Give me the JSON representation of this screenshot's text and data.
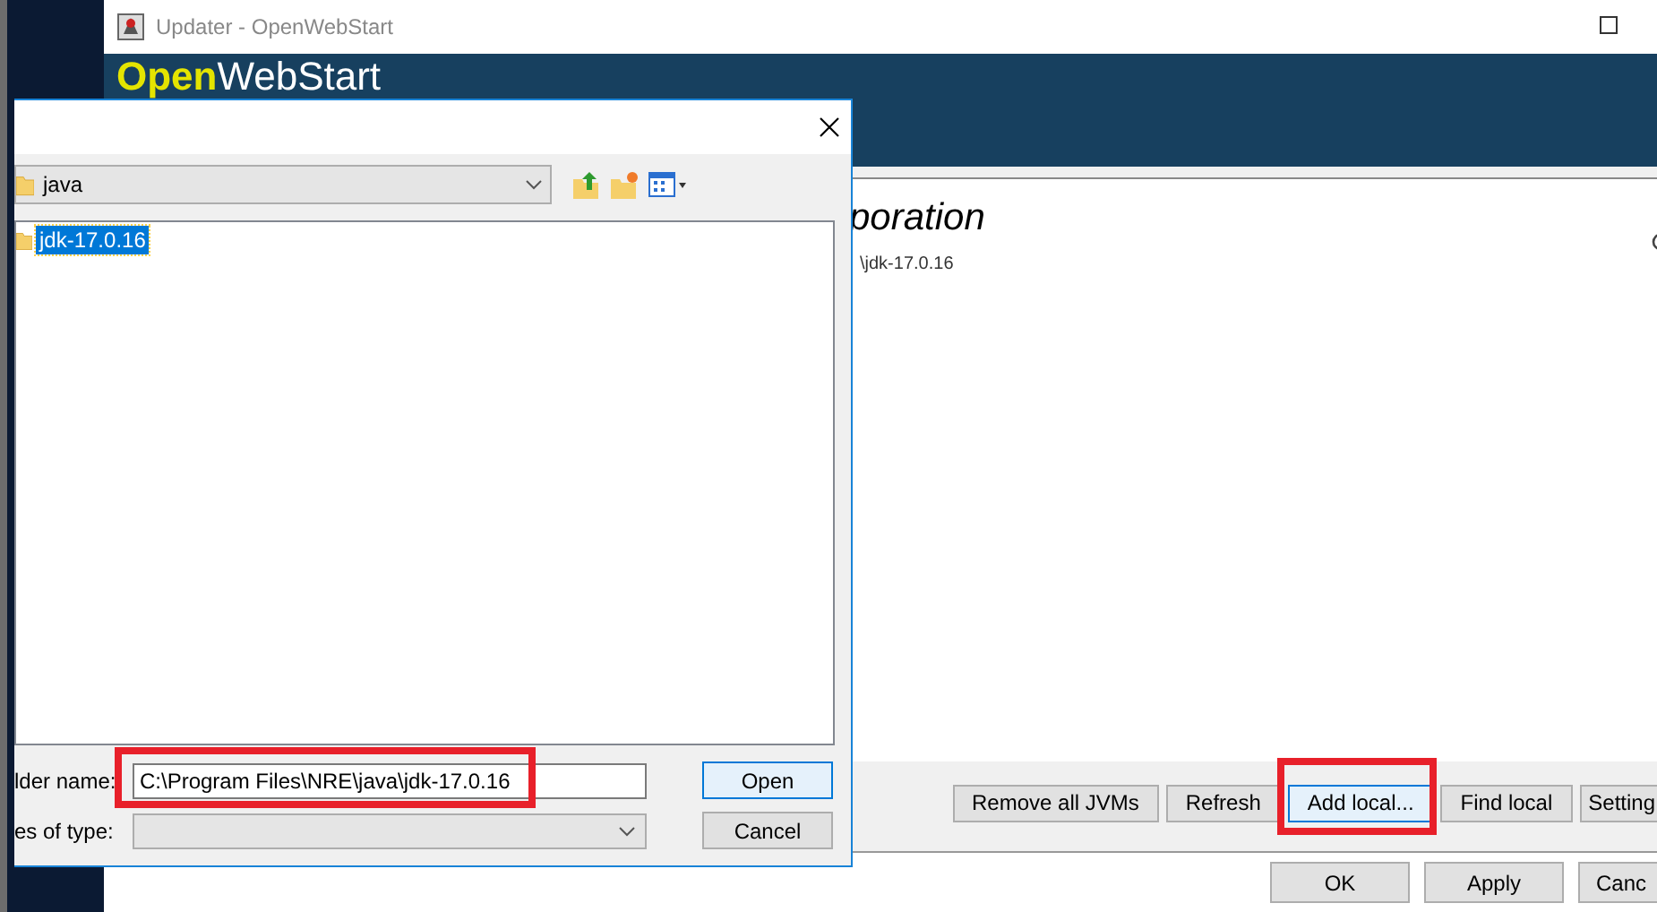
{
  "main_window": {
    "title": "Updater - OpenWebStart",
    "logo": {
      "first": "Open",
      "second": "WebStart"
    },
    "content": {
      "heading": "poration",
      "path": "\\jdk-17.0.16"
    },
    "action_buttons": [
      {
        "label": "Remove all JVMs",
        "highlighted": false
      },
      {
        "label": "Refresh",
        "highlighted": false
      },
      {
        "label": "Add local...",
        "highlighted": true
      },
      {
        "label": "Find local",
        "highlighted": false
      },
      {
        "label": "Setting",
        "highlighted": false
      }
    ],
    "footer_buttons": [
      "OK",
      "Apply",
      "Canc"
    ]
  },
  "file_dialog": {
    "location": "java",
    "files": [
      {
        "name": "jdk-17.0.16",
        "selected": true
      }
    ],
    "folder_name_label": "lder name:",
    "folder_name_value": "C:\\Program Files\\NRE\\java\\jdk-17.0.16",
    "file_type_label": "es of type:",
    "buttons": [
      {
        "label": "Open",
        "default": true
      },
      {
        "label": "Cancel",
        "default": false
      }
    ]
  }
}
